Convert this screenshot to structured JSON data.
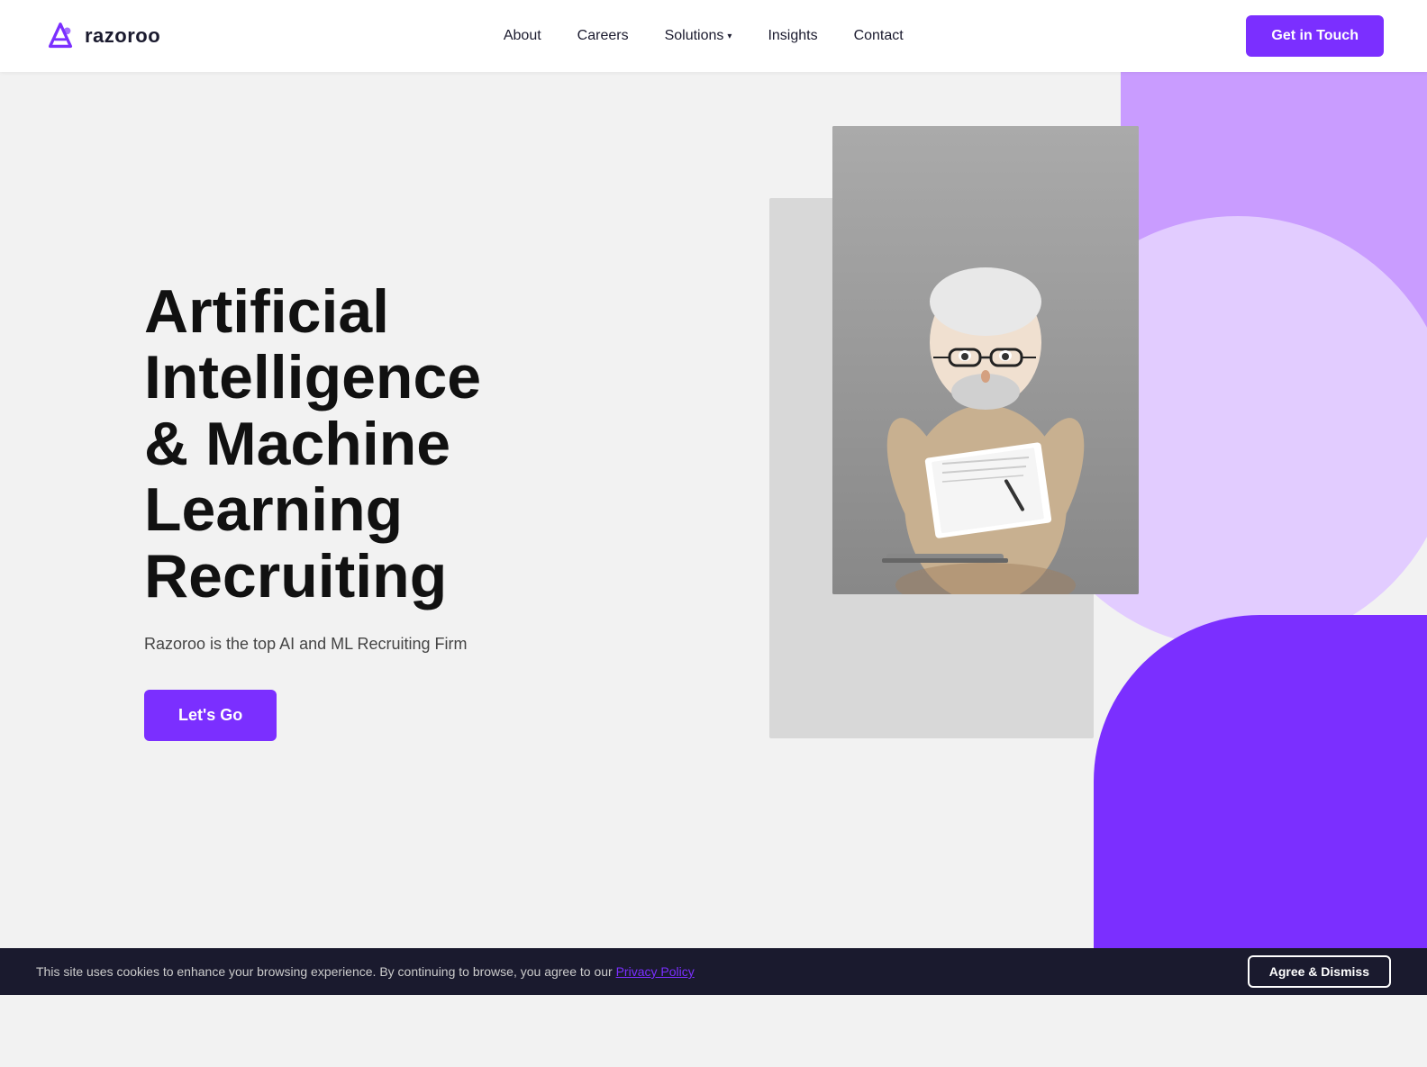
{
  "brand": {
    "name": "razoroo",
    "logo_alt": "Razoroo logo"
  },
  "navbar": {
    "links": [
      {
        "label": "About",
        "href": "#"
      },
      {
        "label": "Careers",
        "href": "#"
      },
      {
        "label": "Solutions",
        "href": "#",
        "has_dropdown": true
      },
      {
        "label": "Insights",
        "href": "#"
      },
      {
        "label": "Contact",
        "href": "#"
      }
    ],
    "cta_label": "Get in Touch"
  },
  "hero": {
    "title": "Artificial Intelligence & Machine Learning Recruiting",
    "subtitle": "Razoroo is the top AI and ML Recruiting Firm",
    "cta_label": "Let's Go"
  },
  "cookie": {
    "text": "This site uses cookies to enhance your browsing experience. By continuing to browse, you agree to our ",
    "link_text": "Privacy Policy",
    "btn_label": "Agree & Dismiss"
  },
  "icons": {
    "chevron_down": "▾",
    "logo_arrow": "➤"
  },
  "colors": {
    "brand_purple": "#7b2fff",
    "light_purple": "#c99cff",
    "dark_navy": "#1a1a2e",
    "bg_gray": "#f2f2f2"
  }
}
